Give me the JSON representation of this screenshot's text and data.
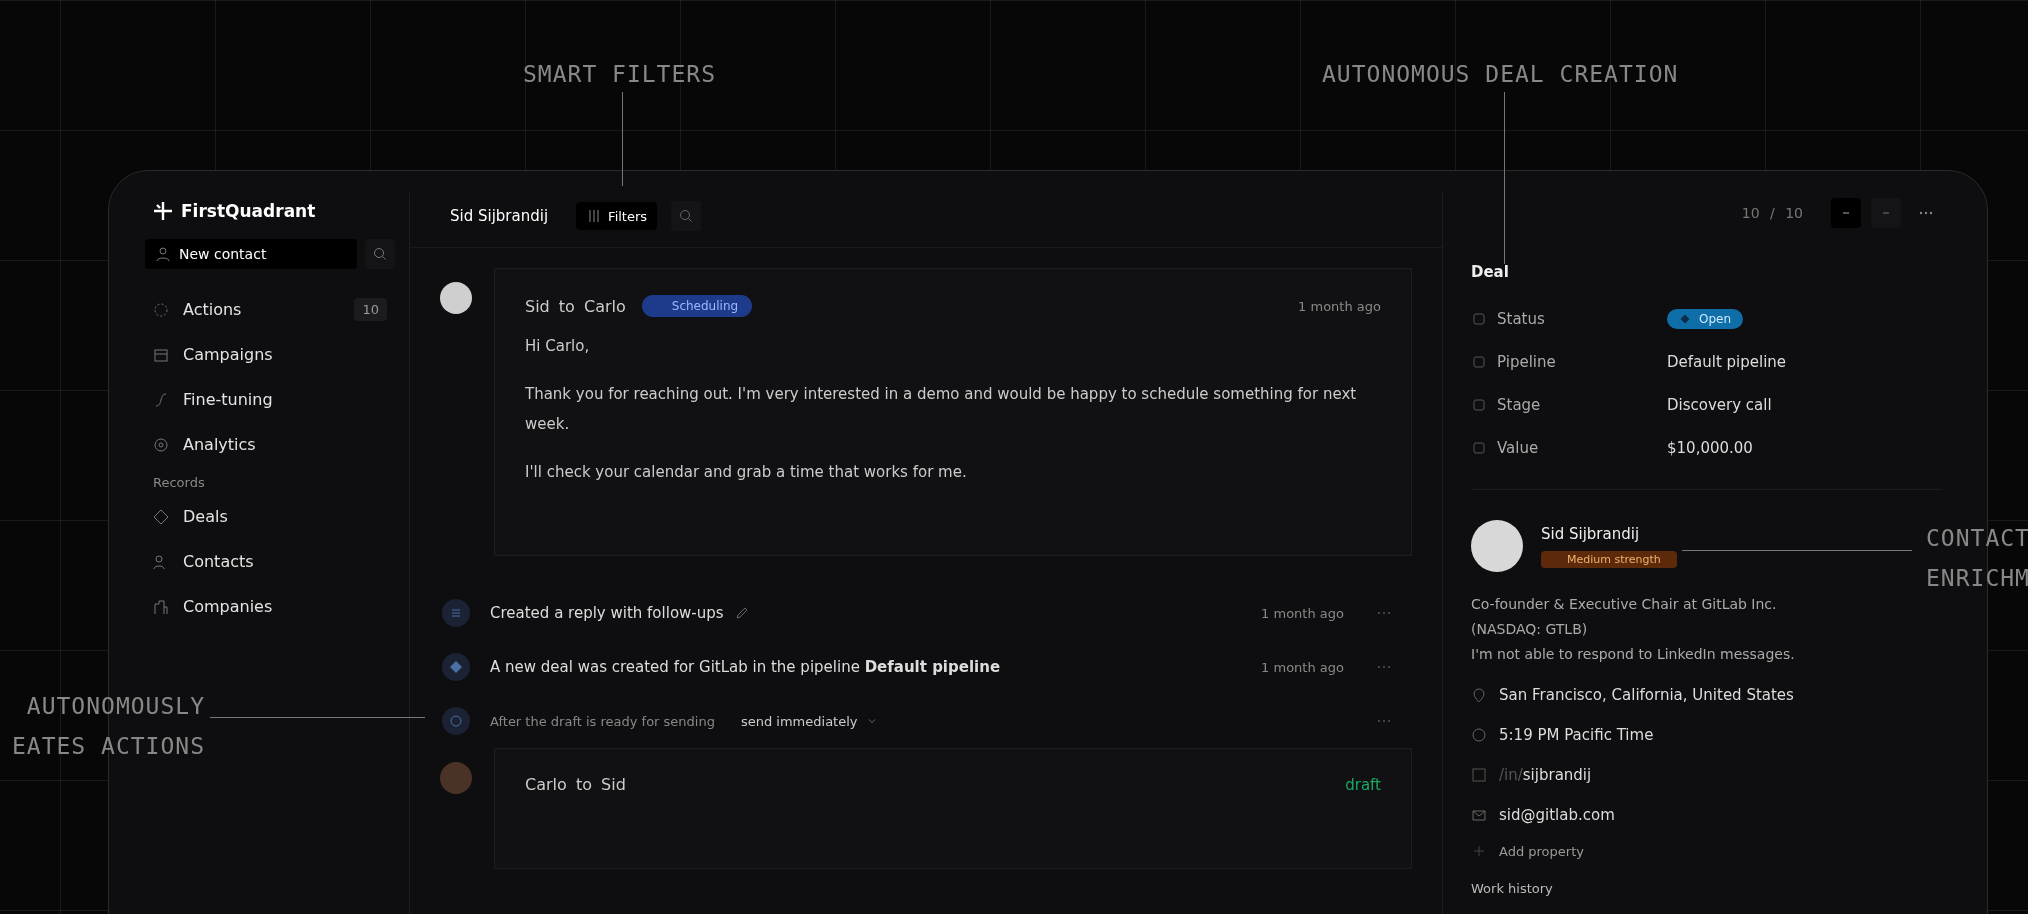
{
  "annotations": [
    {
      "kind": "top",
      "lines": [
        "SMART FILTERS"
      ]
    },
    {
      "kind": "top",
      "lines": [
        "AUTONOMOUS DEAL CREATION"
      ]
    },
    {
      "kind": "left",
      "lines": [
        "AUTONOMOUSLY",
        "EATES ACTIONS"
      ]
    },
    {
      "kind": "right",
      "lines": [
        "CONTACT",
        "ENRICHM"
      ]
    }
  ],
  "sidebar": {
    "brand": "FirstQuadrant",
    "new_contact": "New contact",
    "items": [
      {
        "label": "Actions",
        "badge": "10"
      },
      {
        "label": "Campaigns"
      },
      {
        "label": "Fine-tuning"
      },
      {
        "label": "Analytics"
      }
    ],
    "section": "Records",
    "records": [
      {
        "label": "Deals"
      },
      {
        "label": "Contacts"
      },
      {
        "label": "Companies"
      }
    ]
  },
  "header": {
    "contact_name": "Sid Sijbrandij",
    "filters": "Filters",
    "counter": "10 / 10"
  },
  "message": {
    "title": "Sid to Carlo",
    "tag": "Scheduling",
    "time": "1 month ago",
    "body": [
      "Hi Carlo,",
      "Thank you for reaching out. I'm very interested in a demo and would be happy to schedule something for next week.",
      "I'll check your calendar and grab a time that works for me."
    ]
  },
  "events": [
    {
      "kind": "action",
      "text": "Created a reply with follow-ups",
      "time": "1 month ago"
    },
    {
      "kind": "deal",
      "text": "A new deal was created for GitLab in the pipeline **Default pipeline**",
      "time": "1 month ago"
    },
    {
      "kind": "schedule",
      "text": "After the draft is ready for sending",
      "select": "send immediately"
    }
  ],
  "draft": {
    "title": "Carlo to Sid",
    "status": "draft"
  },
  "deal": {
    "title": "Deal",
    "fields": [
      {
        "label": "Status",
        "kind": "badge",
        "value": "Open"
      },
      {
        "label": "Pipeline",
        "kind": "text",
        "value": "Default pipeline"
      },
      {
        "label": "Stage",
        "kind": "text",
        "value": "Discovery call"
      },
      {
        "label": "Value",
        "kind": "text",
        "value": "$10,000.00"
      }
    ]
  },
  "contact": {
    "name": "Sid Sijbrandij",
    "strength": "Medium strength",
    "bio": [
      "Co-founder & Executive Chair at GitLab Inc.",
      "(NASDAQ: GTLB)",
      "I'm not able to respond to LinkedIn messages."
    ],
    "details": [
      {
        "kind": "location",
        "text": "San Francisco, California, United States"
      },
      {
        "kind": "time",
        "text": "5:19 PM Pacific Time"
      },
      {
        "kind": "linkedin",
        "prefix": "/in/",
        "text": "sijbrandij"
      },
      {
        "kind": "email",
        "text": "sid@gitlab.com"
      }
    ],
    "add_property": "Add property",
    "work_history": "Work history"
  }
}
